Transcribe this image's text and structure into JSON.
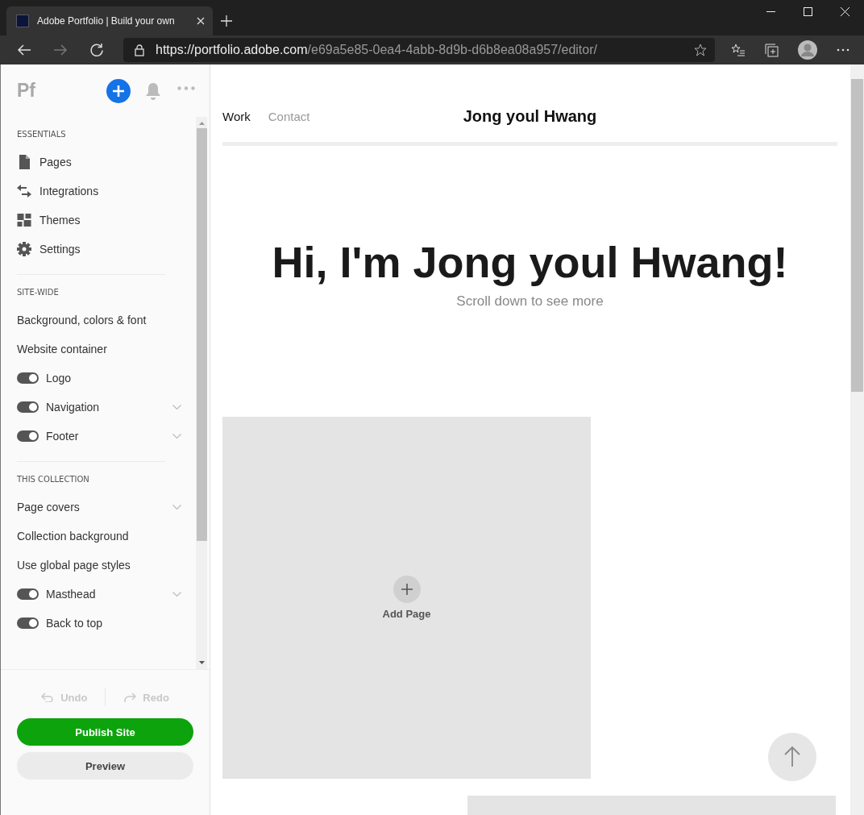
{
  "browser": {
    "tab": {
      "title": "Adobe Portfolio | Build your own"
    },
    "url": {
      "host": "https://portfolio.adobe.com",
      "path": "/e69a5e85-0ea4-4abb-8d9b-d6b8ea08a957/editor/"
    }
  },
  "sidebar": {
    "logo": "Pf",
    "sections": [
      {
        "heading": "ESSENTIALS",
        "items": [
          {
            "label": "Pages",
            "kind": "icon"
          },
          {
            "label": "Integrations",
            "kind": "icon"
          },
          {
            "label": "Themes",
            "kind": "icon"
          },
          {
            "label": "Settings",
            "kind": "icon"
          }
        ]
      },
      {
        "heading": "SITE-WIDE",
        "items": [
          {
            "label": "Background, colors & font",
            "kind": "plain"
          },
          {
            "label": "Website container",
            "kind": "plain"
          },
          {
            "label": "Logo",
            "kind": "toggle",
            "on": true,
            "expandable": false
          },
          {
            "label": "Navigation",
            "kind": "toggle",
            "on": true,
            "expandable": true
          },
          {
            "label": "Footer",
            "kind": "toggle",
            "on": true,
            "expandable": true
          }
        ]
      },
      {
        "heading": "THIS COLLECTION",
        "items": [
          {
            "label": "Page covers",
            "kind": "plain",
            "expandable": true
          },
          {
            "label": "Collection background",
            "kind": "plain"
          },
          {
            "label": "Use global page styles",
            "kind": "plain"
          },
          {
            "label": "Masthead",
            "kind": "toggle",
            "on": true,
            "expandable": true
          },
          {
            "label": "Back to top",
            "kind": "toggle",
            "on": true,
            "expandable": false
          }
        ]
      }
    ],
    "undo": {
      "label": "Undo",
      "disabled": true
    },
    "redo": {
      "label": "Redo",
      "disabled": true
    },
    "publish": "Publish Site",
    "preview": "Preview"
  },
  "site": {
    "nav": [
      {
        "label": "Work",
        "selected": true
      },
      {
        "label": "Contact",
        "selected": false
      }
    ],
    "title": "Jong youl Hwang",
    "heading": "Hi, I'm Jong youl Hwang!",
    "subtitle": "Scroll down to see more",
    "add_page": "Add Page"
  }
}
